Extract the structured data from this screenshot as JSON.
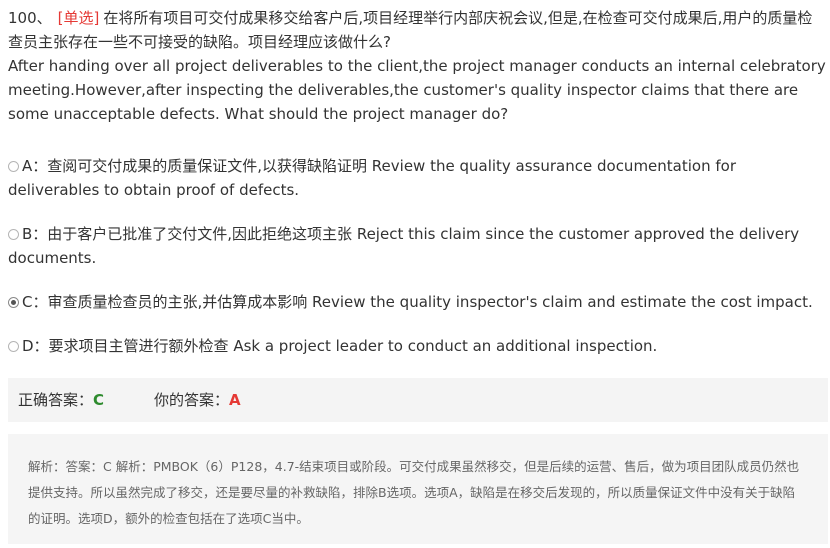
{
  "question": {
    "number": "100、",
    "type": "[单选]",
    "text_cn": "在将所有项目可交付成果移交给客户后,项目经理举行内部庆祝会议,但是,在检查可交付成果后,用户的质量检查员主张存在一些不可接受的缺陷。项目经理应该做什么?",
    "text_en": "After handing over all project deliverables to the client,the project manager conducts an internal celebratory meeting.However,after inspecting the deliverables,the customer's quality inspector claims that there are some unacceptable defects. What should the project manager do?"
  },
  "options": [
    {
      "text": "A：查阅可交付成果的质量保证文件,以获得缺陷证明 Review the quality assurance documentation for deliverables to obtain proof of defects.",
      "selected": false
    },
    {
      "text": "B：由于客户已批准了交付文件,因此拒绝这项主张 Reject this claim since the customer approved the delivery documents.",
      "selected": false
    },
    {
      "text": "C：审查质量检查员的主张,并估算成本影响 Review the quality inspector's claim and estimate the cost impact.",
      "selected": true
    },
    {
      "text": "D：要求项目主管进行额外检查 Ask a project leader to conduct an additional inspection.",
      "selected": false
    }
  ],
  "answer": {
    "correct_label": "正确答案：",
    "correct_value": "C",
    "yours_label": "你的答案：",
    "yours_value": "A",
    "correct_color": "#2e8b2e",
    "wrong_color": "#e53935"
  },
  "analysis": "解析：答案：C 解析：PMBOK（6）P128，4.7-结束项目或阶段。可交付成果虽然移交，但是后续的运营、售后，做为项目团队成员仍然也提供支持。所以虽然完成了移交，还是要尽量的补救缺陷，排除B选项。选项A，缺陷是在移交后发现的，所以质量保证文件中没有关于缺陷的证明。选项D，额外的检查包括在了选项C当中。"
}
